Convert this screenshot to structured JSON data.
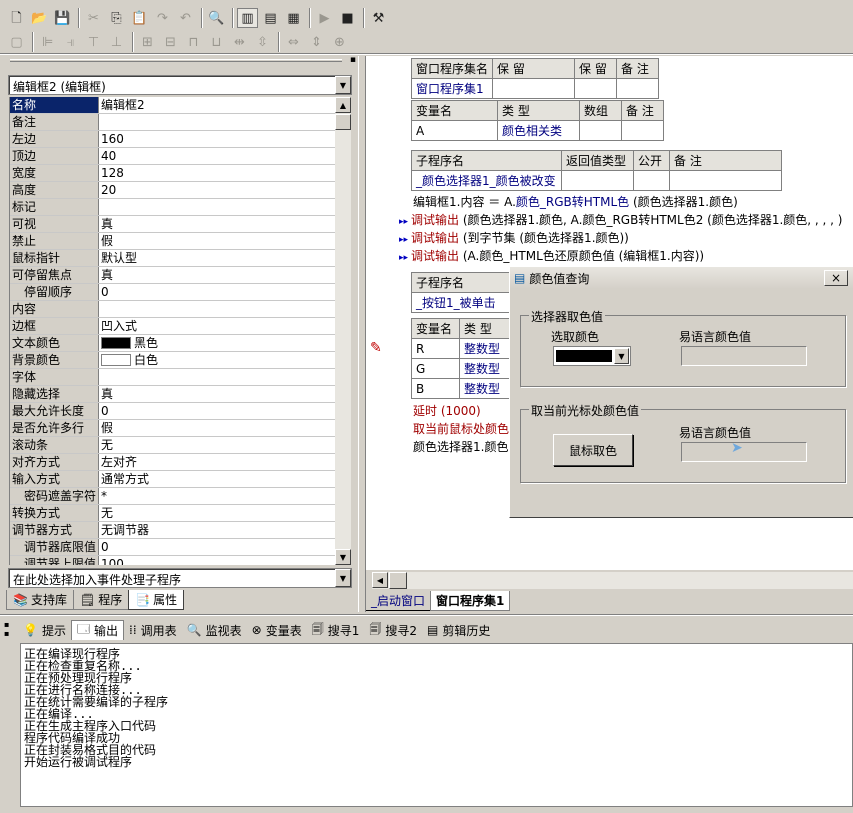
{
  "toolbar1": {
    "icons": [
      "new-icon",
      "open-icon",
      "save-icon",
      "cut-icon",
      "copy-icon",
      "paste-icon",
      "redo-icon",
      "undo-icon",
      "find-icon",
      "layout1-icon",
      "layout2-icon",
      "layout3-icon",
      "run-icon",
      "stop-icon",
      "debug-icon"
    ]
  },
  "props": {
    "selector": "编辑框2 (编辑框)",
    "rows": [
      {
        "name": "名称",
        "value": "编辑框2"
      },
      {
        "name": "备注",
        "value": ""
      },
      {
        "name": "左边",
        "value": "160"
      },
      {
        "name": "顶边",
        "value": "40"
      },
      {
        "name": "宽度",
        "value": "128"
      },
      {
        "name": "高度",
        "value": "20"
      },
      {
        "name": "标记",
        "value": ""
      },
      {
        "name": "可视",
        "value": "真"
      },
      {
        "name": "禁止",
        "value": "假"
      },
      {
        "name": "鼠标指针",
        "value": "默认型"
      },
      {
        "name": "可停留焦点",
        "value": "真"
      },
      {
        "name": "停留顺序",
        "value": "0"
      },
      {
        "name": "内容",
        "value": ""
      },
      {
        "name": "边框",
        "value": "凹入式"
      },
      {
        "name": "文本颜色",
        "value": "黑色"
      },
      {
        "name": "背景颜色",
        "value": "白色"
      },
      {
        "name": "字体",
        "value": ""
      },
      {
        "name": "隐藏选择",
        "value": "真"
      },
      {
        "name": "最大允许长度",
        "value": "0"
      },
      {
        "name": "是否允许多行",
        "value": "假"
      },
      {
        "name": "滚动条",
        "value": "无"
      },
      {
        "name": "对齐方式",
        "value": "左对齐"
      },
      {
        "name": "输入方式",
        "value": "通常方式"
      },
      {
        "name": "密码遮盖字符",
        "value": "*"
      },
      {
        "name": "转换方式",
        "value": "无"
      },
      {
        "name": "调节器方式",
        "value": "无调节器"
      },
      {
        "name": "调节器底限值",
        "value": "0"
      },
      {
        "name": "调节器上限值",
        "value": "100"
      }
    ],
    "event_selector": "在此处选择加入事件处理子程序",
    "tabs": [
      "支持库",
      "程序",
      "属性"
    ]
  },
  "editor": {
    "table1": {
      "headers": [
        "窗口程序集名",
        "保 留",
        "保 留",
        "备 注"
      ],
      "row": [
        "窗口程序集1",
        "",
        "",
        ""
      ]
    },
    "table2": {
      "headers": [
        "变量名",
        "类 型",
        "数组",
        "备 注"
      ],
      "row": [
        "A",
        "颜色相关类",
        "",
        ""
      ]
    },
    "table3": {
      "headers": [
        "子程序名",
        "返回值类型",
        "公开",
        "备 注"
      ],
      "row": [
        "_颜色选择器1_颜色被改变",
        "",
        "",
        ""
      ]
    },
    "code1": [
      {
        "a": "编辑框1.内容 ＝ A.",
        "b": "颜色_RGB转HTML色",
        "c": " (颜色选择器1.颜色)"
      },
      {
        "a": "调试输出",
        "b": " (颜色选择器1.颜色, A.颜色_RGB转HTML色2 (颜色选择器1.颜色, , , , )",
        "c": ""
      },
      {
        "a": "调试输出",
        "b": " (到字节集 (颜色选择器1.颜色))",
        "c": ""
      },
      {
        "a": "调试输出",
        "b": " (A.颜色_HTML色还原颜色值 (编辑框1.内容))",
        "c": ""
      }
    ],
    "table4": {
      "headers": [
        "子程序名"
      ],
      "row": [
        "_按钮1_被单击"
      ]
    },
    "table5": {
      "headers": [
        "变量名",
        "类 型"
      ],
      "rows": [
        [
          "R",
          "整数型"
        ],
        [
          "G",
          "整数型"
        ],
        [
          "B",
          "整数型"
        ]
      ]
    },
    "code2": [
      "延时 (1000)",
      "取当前鼠标处颜色",
      "颜色选择器1.颜色"
    ],
    "tabs": [
      "_启动窗口",
      "窗口程序集1"
    ]
  },
  "dialog": {
    "title": "颜色值查询",
    "close": "×",
    "group1": {
      "legend": "选择器取色值",
      "label1": "选取颜色",
      "label2": "易语言颜色值"
    },
    "group2": {
      "legend": "取当前光标处颜色值",
      "label2": "易语言颜色值",
      "button": "鼠标取色"
    }
  },
  "bottom": {
    "tabs": [
      "提示",
      "输出",
      "调用表",
      "监视表",
      "变量表",
      "搜寻1",
      "搜寻2",
      "剪辑历史"
    ],
    "output": [
      "正在编译现行程序",
      "正在检查重复名称...",
      "正在预处理现行程序",
      "正在进行名称连接...",
      "正在统计需要编译的子程序",
      "正在编译...",
      "正在生成主程序入口代码",
      "程序代码编译成功",
      "正在封装易格式目的代码",
      "开始运行被调试程序"
    ]
  }
}
